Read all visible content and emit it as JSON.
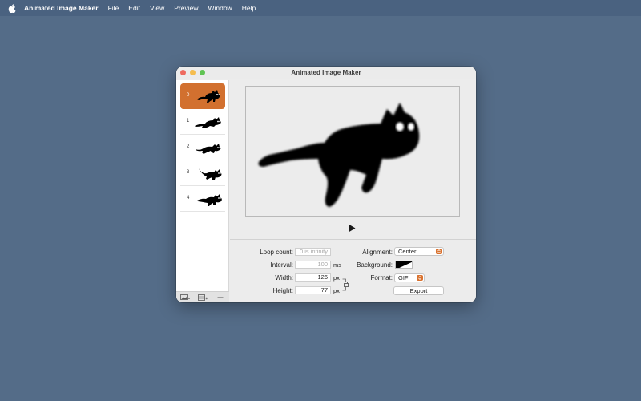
{
  "menubar": {
    "app_name": "Animated Image Maker",
    "items": [
      "File",
      "Edit",
      "View",
      "Preview",
      "Window",
      "Help"
    ]
  },
  "window": {
    "title": "Animated Image Maker"
  },
  "frames": [
    {
      "index": "0",
      "selected": true
    },
    {
      "index": "1",
      "selected": false
    },
    {
      "index": "2",
      "selected": false
    },
    {
      "index": "3",
      "selected": false
    },
    {
      "index": "4",
      "selected": false
    }
  ],
  "sidebar_toolbar": {
    "buttons": [
      "add-image-icon",
      "add-frames-icon",
      "remove-icon"
    ],
    "remove_label": "—"
  },
  "settings": {
    "loop_count_label": "Loop count:",
    "loop_count_placeholder": "0 is infinity",
    "interval_label": "Interval:",
    "interval_value": "100",
    "interval_unit": "ms",
    "width_label": "Width:",
    "width_value": "126",
    "width_unit": "px",
    "height_label": "Height:",
    "height_value": "77",
    "height_unit": "px",
    "alignment_label": "Alignment:",
    "alignment_value": "Center",
    "background_label": "Background:",
    "format_label": "Format:",
    "format_value": "GIF",
    "export_label": "Export"
  },
  "colors": {
    "desktop": "#546c88",
    "accent": "#d2702f"
  }
}
